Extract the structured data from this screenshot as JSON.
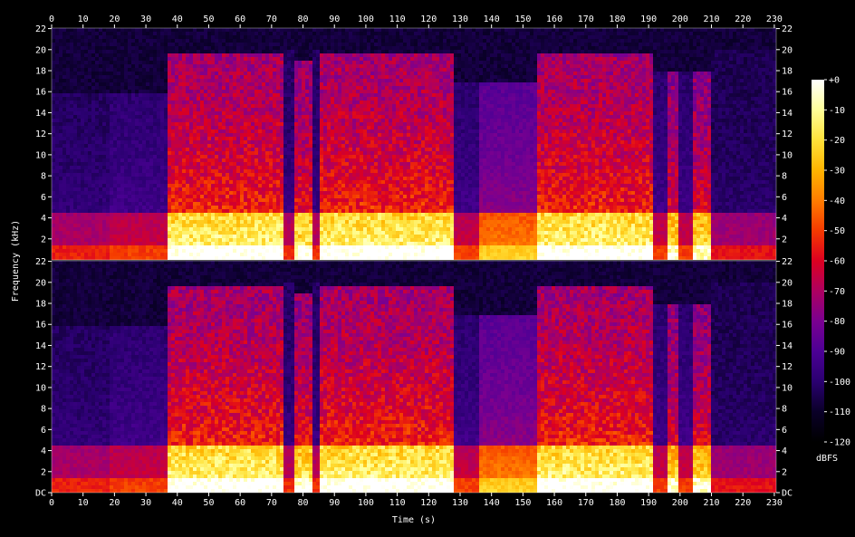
{
  "chart_data": {
    "type": "heatmap",
    "subtype": "spectrogram",
    "channels": 2,
    "xlabel": "Time (s)",
    "ylabel": "Frequency (kHz)",
    "xlim": [
      0,
      230.6
    ],
    "ylim": [
      0,
      22.05
    ],
    "x_ticks": [
      0,
      10,
      20,
      30,
      40,
      50,
      60,
      70,
      80,
      90,
      100,
      110,
      120,
      130,
      140,
      150,
      160,
      170,
      180,
      190,
      200,
      210,
      220,
      230
    ],
    "y_ticks": [
      0,
      2,
      4,
      6,
      8,
      10,
      12,
      14,
      16,
      18,
      20,
      22
    ],
    "y_tick_labels": [
      "DC",
      "2",
      "4",
      "6",
      "8",
      "10",
      "12",
      "14",
      "16",
      "18",
      "20",
      "22"
    ],
    "colorbar": {
      "label": "dBFS",
      "range": [
        -120,
        0
      ],
      "ticks": [
        "+0",
        "-10",
        "-20",
        "-30",
        "-40",
        "-50",
        "-60",
        "-70",
        "-80",
        "-90",
        "-100",
        "-110",
        "-120"
      ],
      "colors": [
        "#000000",
        "#0a0028",
        "#2a0070",
        "#4c0095",
        "#7a0090",
        "#ad0060",
        "#dc0020",
        "#f53a00",
        "#ff7c00",
        "#ffb400",
        "#ffe13a",
        "#ffff98",
        "#ffffff"
      ]
    },
    "segments": [
      {
        "start": 0,
        "end": 18.5,
        "level": 0.2,
        "top_khz": 16
      },
      {
        "start": 18.5,
        "end": 36.5,
        "level": 0.24,
        "top_khz": 16
      },
      {
        "start": 36.5,
        "end": 74,
        "level": 0.62,
        "top_khz": 19.5
      },
      {
        "start": 74,
        "end": 77.5,
        "level": 0.22,
        "top_khz": 20
      },
      {
        "start": 77.5,
        "end": 82.5,
        "level": 0.58,
        "top_khz": 19
      },
      {
        "start": 82.5,
        "end": 85,
        "level": 0.22,
        "top_khz": 20
      },
      {
        "start": 85,
        "end": 128,
        "level": 0.62,
        "top_khz": 19.5
      },
      {
        "start": 128,
        "end": 136,
        "level": 0.24,
        "top_khz": 17
      },
      {
        "start": 136,
        "end": 154,
        "level": 0.4,
        "top_khz": 17
      },
      {
        "start": 154,
        "end": 191,
        "level": 0.62,
        "top_khz": 19.5
      },
      {
        "start": 191,
        "end": 196,
        "level": 0.24,
        "top_khz": 18
      },
      {
        "start": 196,
        "end": 200,
        "level": 0.55,
        "top_khz": 18
      },
      {
        "start": 200,
        "end": 204,
        "level": 0.24,
        "top_khz": 18
      },
      {
        "start": 204,
        "end": 210,
        "level": 0.55,
        "top_khz": 18
      },
      {
        "start": 210,
        "end": 230.6,
        "level": 0.18,
        "top_khz": 20
      }
    ]
  }
}
